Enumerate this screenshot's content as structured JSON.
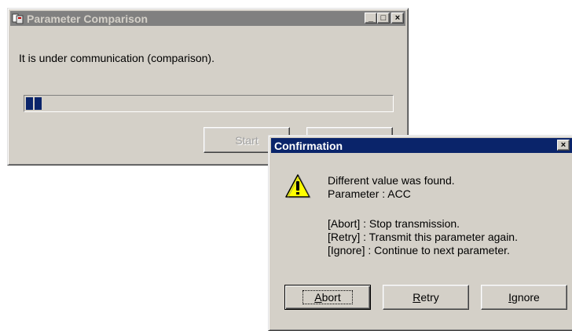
{
  "param_window": {
    "title": "Parameter Comparison",
    "message": "It is under communication (comparison).",
    "progress_fraction": 0.04,
    "start_label": "Start",
    "buttons": {
      "minimize": "_",
      "maximize": "□",
      "close": "×"
    }
  },
  "confirm_dialog": {
    "title": "Confirmation",
    "line1": "Different value was found.",
    "line2": "Parameter : ACC",
    "line3": "[Abort] : Stop transmission.",
    "line4": "[Retry] : Transmit this parameter again.",
    "line5": "[Ignore] : Continue to next parameter.",
    "abort_hotkey": "A",
    "abort_rest": "bort",
    "retry_hotkey": "R",
    "retry_rest": "etry",
    "ignore_hotkey": "I",
    "ignore_rest": "gnore",
    "close": "×",
    "icon": "warning-icon"
  },
  "colors": {
    "active_title": "#0a246a",
    "inactive_title": "#808080",
    "face": "#d4d0c8",
    "progress": "#0a246a"
  }
}
